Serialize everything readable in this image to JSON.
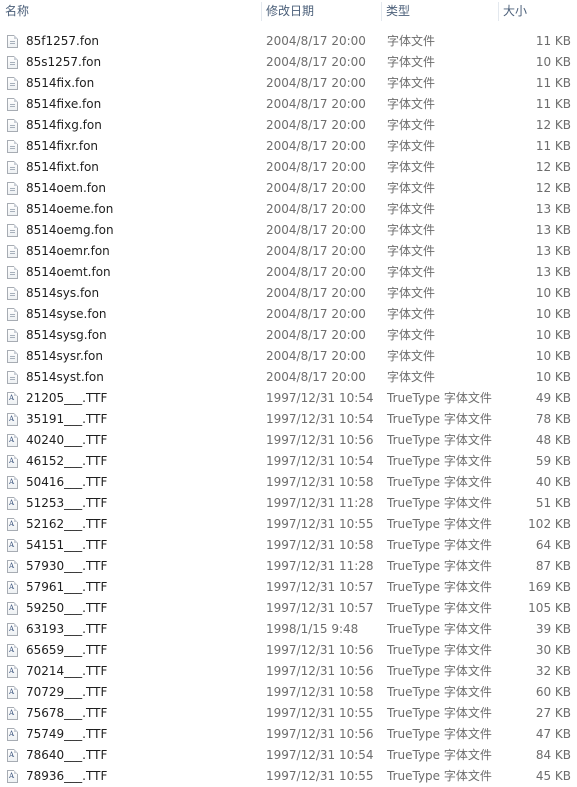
{
  "columns": {
    "name": "名称",
    "date": "修改日期",
    "type": "类型",
    "size": "大小"
  },
  "files": [
    {
      "name": "85f1257.fon",
      "date": "2004/8/17 20:00",
      "type": "字体文件",
      "size": "11 KB",
      "icon": "fon"
    },
    {
      "name": "85s1257.fon",
      "date": "2004/8/17 20:00",
      "type": "字体文件",
      "size": "10 KB",
      "icon": "fon"
    },
    {
      "name": "8514fix.fon",
      "date": "2004/8/17 20:00",
      "type": "字体文件",
      "size": "11 KB",
      "icon": "fon"
    },
    {
      "name": "8514fixe.fon",
      "date": "2004/8/17 20:00",
      "type": "字体文件",
      "size": "11 KB",
      "icon": "fon"
    },
    {
      "name": "8514fixg.fon",
      "date": "2004/8/17 20:00",
      "type": "字体文件",
      "size": "12 KB",
      "icon": "fon"
    },
    {
      "name": "8514fixr.fon",
      "date": "2004/8/17 20:00",
      "type": "字体文件",
      "size": "11 KB",
      "icon": "fon"
    },
    {
      "name": "8514fixt.fon",
      "date": "2004/8/17 20:00",
      "type": "字体文件",
      "size": "12 KB",
      "icon": "fon"
    },
    {
      "name": "8514oem.fon",
      "date": "2004/8/17 20:00",
      "type": "字体文件",
      "size": "12 KB",
      "icon": "fon"
    },
    {
      "name": "8514oeme.fon",
      "date": "2004/8/17 20:00",
      "type": "字体文件",
      "size": "13 KB",
      "icon": "fon"
    },
    {
      "name": "8514oemg.fon",
      "date": "2004/8/17 20:00",
      "type": "字体文件",
      "size": "13 KB",
      "icon": "fon"
    },
    {
      "name": "8514oemr.fon",
      "date": "2004/8/17 20:00",
      "type": "字体文件",
      "size": "13 KB",
      "icon": "fon"
    },
    {
      "name": "8514oemt.fon",
      "date": "2004/8/17 20:00",
      "type": "字体文件",
      "size": "13 KB",
      "icon": "fon"
    },
    {
      "name": "8514sys.fon",
      "date": "2004/8/17 20:00",
      "type": "字体文件",
      "size": "10 KB",
      "icon": "fon"
    },
    {
      "name": "8514syse.fon",
      "date": "2004/8/17 20:00",
      "type": "字体文件",
      "size": "10 KB",
      "icon": "fon"
    },
    {
      "name": "8514sysg.fon",
      "date": "2004/8/17 20:00",
      "type": "字体文件",
      "size": "10 KB",
      "icon": "fon"
    },
    {
      "name": "8514sysr.fon",
      "date": "2004/8/17 20:00",
      "type": "字体文件",
      "size": "10 KB",
      "icon": "fon"
    },
    {
      "name": "8514syst.fon",
      "date": "2004/8/17 20:00",
      "type": "字体文件",
      "size": "10 KB",
      "icon": "fon"
    },
    {
      "name": "21205___.TTF",
      "date": "1997/12/31 10:54",
      "type": "TrueType 字体文件",
      "size": "49 KB",
      "icon": "ttf"
    },
    {
      "name": "35191___.TTF",
      "date": "1997/12/31 10:54",
      "type": "TrueType 字体文件",
      "size": "78 KB",
      "icon": "ttf"
    },
    {
      "name": "40240___.TTF",
      "date": "1997/12/31 10:56",
      "type": "TrueType 字体文件",
      "size": "48 KB",
      "icon": "ttf"
    },
    {
      "name": "46152___.TTF",
      "date": "1997/12/31 10:54",
      "type": "TrueType 字体文件",
      "size": "59 KB",
      "icon": "ttf"
    },
    {
      "name": "50416___.TTF",
      "date": "1997/12/31 10:58",
      "type": "TrueType 字体文件",
      "size": "40 KB",
      "icon": "ttf"
    },
    {
      "name": "51253___.TTF",
      "date": "1997/12/31 11:28",
      "type": "TrueType 字体文件",
      "size": "51 KB",
      "icon": "ttf"
    },
    {
      "name": "52162___.TTF",
      "date": "1997/12/31 10:55",
      "type": "TrueType 字体文件",
      "size": "102 KB",
      "icon": "ttf"
    },
    {
      "name": "54151___.TTF",
      "date": "1997/12/31 10:58",
      "type": "TrueType 字体文件",
      "size": "64 KB",
      "icon": "ttf"
    },
    {
      "name": "57930___.TTF",
      "date": "1997/12/31 11:28",
      "type": "TrueType 字体文件",
      "size": "87 KB",
      "icon": "ttf"
    },
    {
      "name": "57961___.TTF",
      "date": "1997/12/31 10:57",
      "type": "TrueType 字体文件",
      "size": "169 KB",
      "icon": "ttf"
    },
    {
      "name": "59250___.TTF",
      "date": "1997/12/31 10:57",
      "type": "TrueType 字体文件",
      "size": "105 KB",
      "icon": "ttf"
    },
    {
      "name": "63193___.TTF",
      "date": "1998/1/15 9:48",
      "type": "TrueType 字体文件",
      "size": "39 KB",
      "icon": "ttf"
    },
    {
      "name": "65659___.TTF",
      "date": "1997/12/31 10:56",
      "type": "TrueType 字体文件",
      "size": "30 KB",
      "icon": "ttf"
    },
    {
      "name": "70214___.TTF",
      "date": "1997/12/31 10:56",
      "type": "TrueType 字体文件",
      "size": "32 KB",
      "icon": "ttf"
    },
    {
      "name": "70729___.TTF",
      "date": "1997/12/31 10:58",
      "type": "TrueType 字体文件",
      "size": "60 KB",
      "icon": "ttf"
    },
    {
      "name": "75678___.TTF",
      "date": "1997/12/31 10:55",
      "type": "TrueType 字体文件",
      "size": "27 KB",
      "icon": "ttf"
    },
    {
      "name": "75749___.TTF",
      "date": "1997/12/31 10:56",
      "type": "TrueType 字体文件",
      "size": "47 KB",
      "icon": "ttf"
    },
    {
      "name": "78640___.TTF",
      "date": "1997/12/31 10:54",
      "type": "TrueType 字体文件",
      "size": "84 KB",
      "icon": "ttf"
    },
    {
      "name": "78936___.TTF",
      "date": "1997/12/31 10:55",
      "type": "TrueType 字体文件",
      "size": "45 KB",
      "icon": "ttf"
    }
  ]
}
